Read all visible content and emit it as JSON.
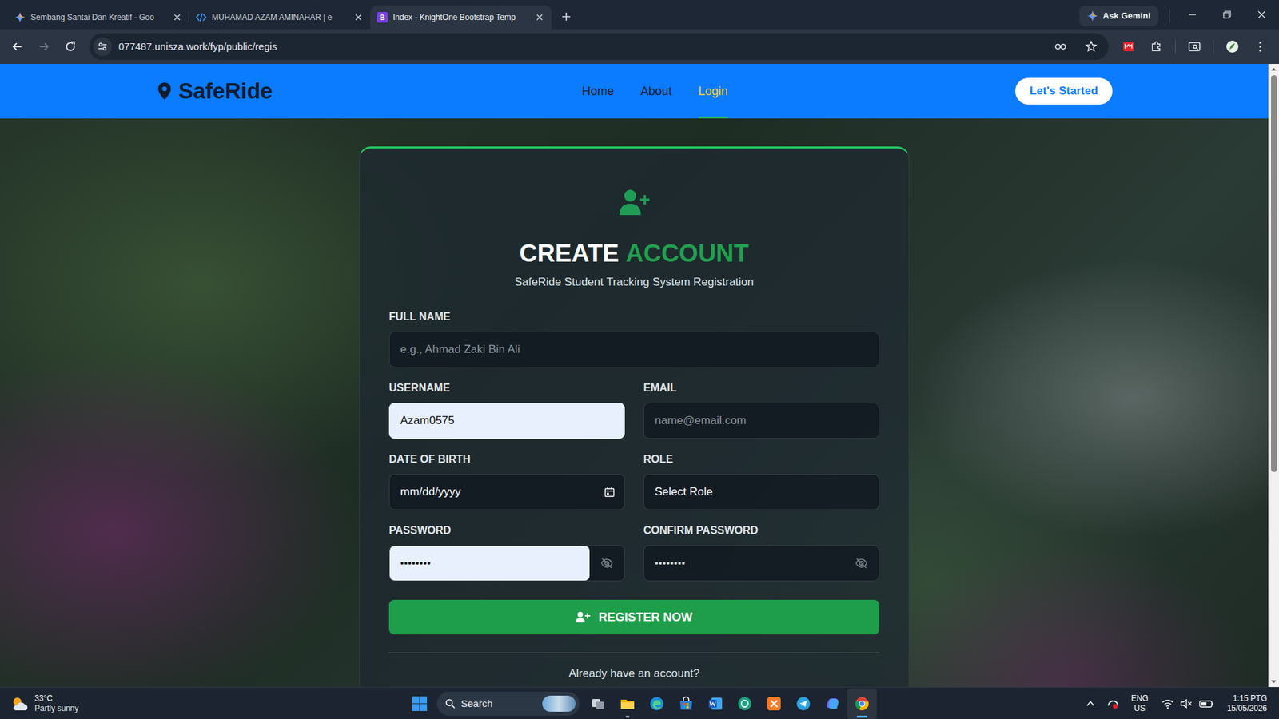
{
  "browser": {
    "tabs": [
      {
        "label": "Sembang Santai Dan Kreatif - Goo",
        "selected": false,
        "kind": "gemini"
      },
      {
        "label": "MUHAMAD AZAM AMINAHAR | e",
        "selected": false,
        "kind": "code"
      },
      {
        "label": "Index - KnightOne Bootstrap Temp",
        "selected": true,
        "kind": "bootstrap",
        "badge": "B"
      }
    ],
    "ask_gemini": "Ask Gemini",
    "url": "077487.unisza.work/fyp/public/regis"
  },
  "site": {
    "brand": "SafeRide",
    "nav": [
      {
        "label": "Home",
        "selected": false
      },
      {
        "label": "About",
        "selected": false
      },
      {
        "label": "Login",
        "selected": true
      }
    ],
    "cta": "Let's Started"
  },
  "form": {
    "title_a": "CREATE",
    "title_b": "ACCOUNT",
    "subtitle": "SafeRide Student Tracking System Registration",
    "rows": [
      [
        {
          "label": "FULL NAME",
          "kind": "text",
          "placeholder": "e.g., Ahmad Zaki Bin Ali",
          "autofilled": false
        }
      ],
      [
        {
          "label": "USERNAME",
          "kind": "text",
          "value": "Azam0575",
          "autofilled": true
        },
        {
          "label": "EMAIL",
          "kind": "text",
          "placeholder": "name@email.com",
          "autofilled": false
        }
      ],
      [
        {
          "label": "DATE OF BIRTH",
          "kind": "date",
          "value": "mm/dd/yyyy",
          "autofilled": false
        },
        {
          "label": "ROLE",
          "kind": "select",
          "value": "Select Role",
          "autofilled": false
        }
      ],
      [
        {
          "label": "PASSWORD",
          "kind": "password",
          "value": "••••••••",
          "autofilled": true
        },
        {
          "label": "CONFIRM PASSWORD",
          "kind": "password",
          "value": "••••••••",
          "autofilled": false
        }
      ]
    ],
    "submit": "REGISTER NOW",
    "footer": "Already have an account?"
  },
  "scrollbar": {
    "level": 0.66
  },
  "taskbar": {
    "weather": {
      "temp": "33°C",
      "desc": "Partly sunny"
    },
    "search": "Search",
    "apps": [
      {
        "kind": "taskview",
        "running": false,
        "selected": false
      },
      {
        "kind": "explorer",
        "running": true,
        "selected": false
      },
      {
        "kind": "edge",
        "running": false,
        "selected": false
      },
      {
        "kind": "store",
        "running": false,
        "selected": false
      },
      {
        "kind": "word",
        "running": false,
        "selected": false
      },
      {
        "kind": "chatgpt",
        "running": false,
        "selected": false
      },
      {
        "kind": "xampp",
        "running": false,
        "selected": false
      },
      {
        "kind": "telegram",
        "running": false,
        "selected": false
      },
      {
        "kind": "copilot",
        "running": false,
        "selected": false
      },
      {
        "kind": "chrome",
        "running": true,
        "selected": true
      }
    ],
    "lang": "ENG",
    "region": "US",
    "time": "1:15 PTG",
    "date": "15/05/2026"
  }
}
